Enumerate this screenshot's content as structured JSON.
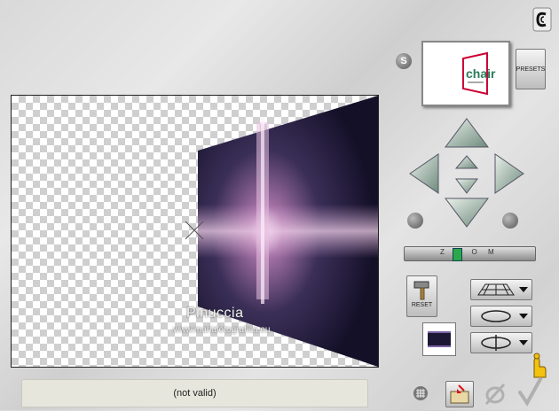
{
  "canvas": {
    "watermark_name": "Pinuccia",
    "watermark_site": "www.mariafotografica.eu"
  },
  "status": {
    "text": "(not valid)"
  },
  "panel": {
    "presets_label": "PRESETS",
    "s_label": "S",
    "reset_label": "RESET",
    "preview_text": "chair",
    "zoom_label": "Z O O M"
  },
  "colors": {
    "accent": "#7b63a6",
    "zoom_thumb": "#2aa84a",
    "check_mark": "#b0b0b0",
    "pointer_hand": "#f3c20f"
  },
  "icons": [
    "logo-c-icon",
    "arrow-up-icon",
    "arrow-down-icon",
    "arrow-left-icon",
    "arrow-right-icon",
    "rotate-left-icon",
    "rotate-right-icon",
    "hammer-icon",
    "grid-icon",
    "folder-arrow-icon",
    "cancel-icon",
    "ok-check-icon",
    "pointing-hand-icon"
  ]
}
